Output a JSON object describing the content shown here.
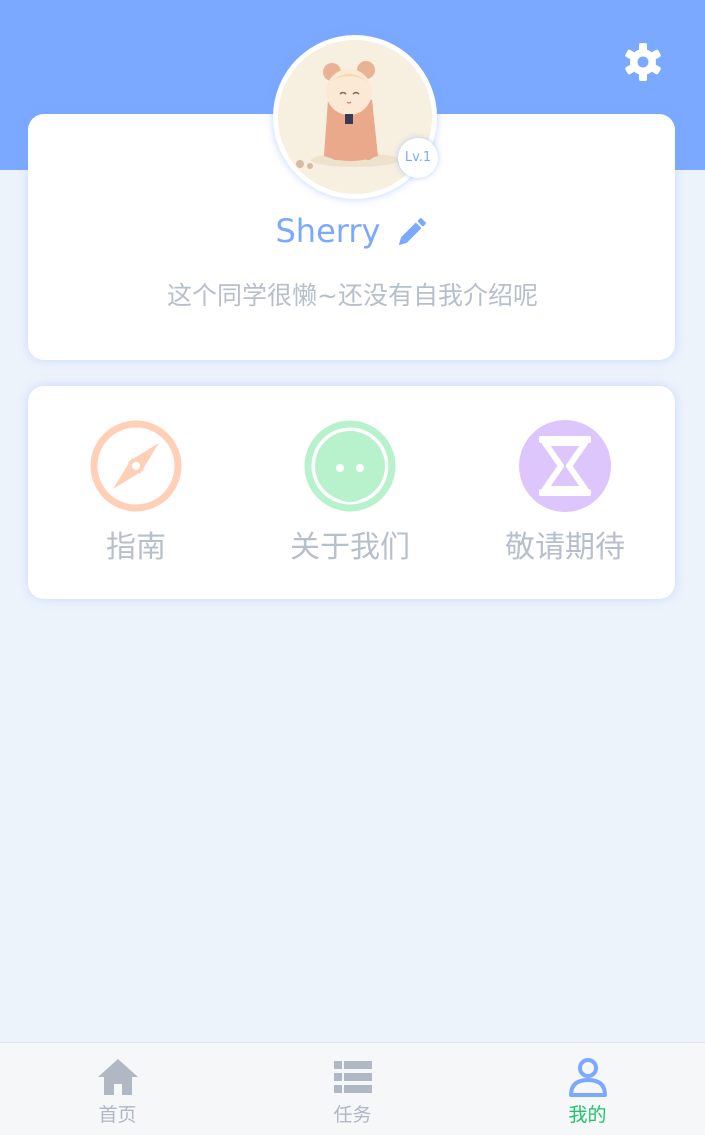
{
  "profile": {
    "name": "Sherry",
    "level": "Lv.1",
    "bio": "这个同学很懒~还没有自我介绍呢"
  },
  "menu": [
    {
      "label": "指南",
      "icon": "compass-icon",
      "color": "#ffcfb8"
    },
    {
      "label": "关于我们",
      "icon": "smiley-face-icon",
      "color": "#b8f2cd"
    },
    {
      "label": "敬请期待",
      "icon": "hourglass-icon",
      "color": "#ddc6fb"
    }
  ],
  "tabbar": {
    "active_color": "#1ec46c",
    "inactive_color": "#b0b8c4",
    "items": [
      {
        "label": "首页",
        "icon": "home-icon"
      },
      {
        "label": "任务",
        "icon": "list-icon"
      },
      {
        "label": "我的",
        "icon": "user-icon",
        "active": true
      }
    ]
  },
  "colors": {
    "header": "#7ba9ff",
    "background": "#edf3fb",
    "accent": "#7ba9ff"
  }
}
